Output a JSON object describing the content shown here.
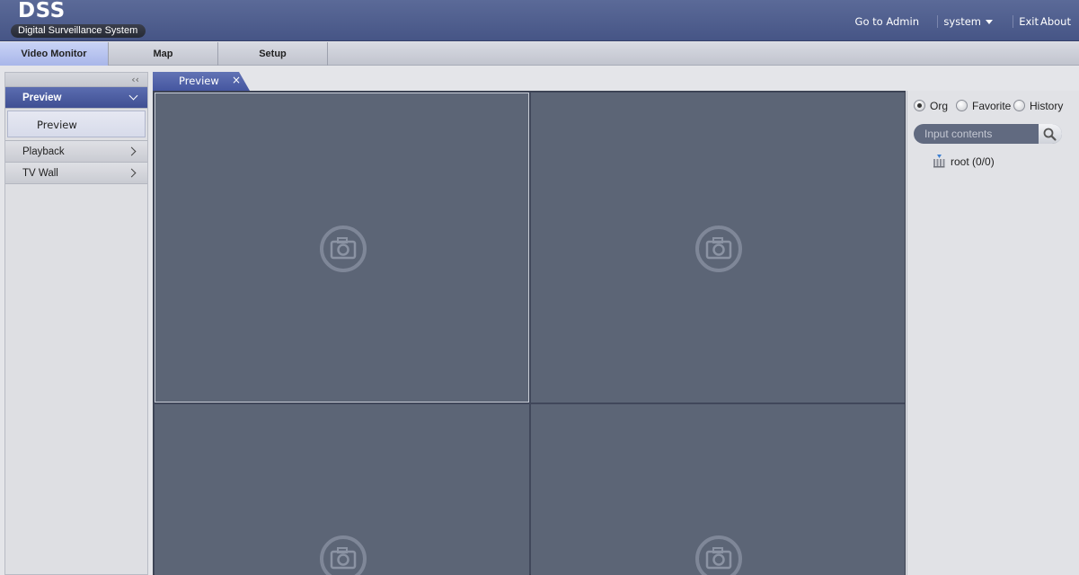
{
  "header": {
    "logo_title": "DSS",
    "logo_subtitle": "Digital Surveillance System",
    "links": {
      "go_to_admin": "Go to Admin",
      "user": "system",
      "exit": "Exit",
      "about": "About"
    }
  },
  "mainnav": {
    "items": [
      {
        "label": "Video Monitor",
        "active": true
      },
      {
        "label": "Map",
        "active": false
      },
      {
        "label": "Setup",
        "active": false
      }
    ]
  },
  "sidebar": {
    "collapse_icon": "double-chevron-left-icon",
    "sections": [
      {
        "label": "Preview",
        "expanded": true,
        "children": [
          "Preview"
        ]
      },
      {
        "label": "Playback",
        "expanded": false
      },
      {
        "label": "TV Wall",
        "expanded": false
      }
    ]
  },
  "tabs": [
    {
      "label": "Preview",
      "close_glyph": "×"
    }
  ],
  "video_grid": {
    "layout": "2x2",
    "selected_pane": 0,
    "pane_icon": "camera-icon"
  },
  "device_panel": {
    "modes": [
      {
        "label": "Org",
        "selected": true
      },
      {
        "label": "Favorite",
        "selected": false
      },
      {
        "label": "History",
        "selected": false
      }
    ],
    "search": {
      "placeholder": "Input contents",
      "value": ""
    },
    "tree": [
      {
        "label": "root (0/0)",
        "icon": "device-tree-root-icon"
      }
    ]
  },
  "colors": {
    "header": "#4a5989",
    "accent": "#4556a0",
    "pane": "#5c6576"
  }
}
